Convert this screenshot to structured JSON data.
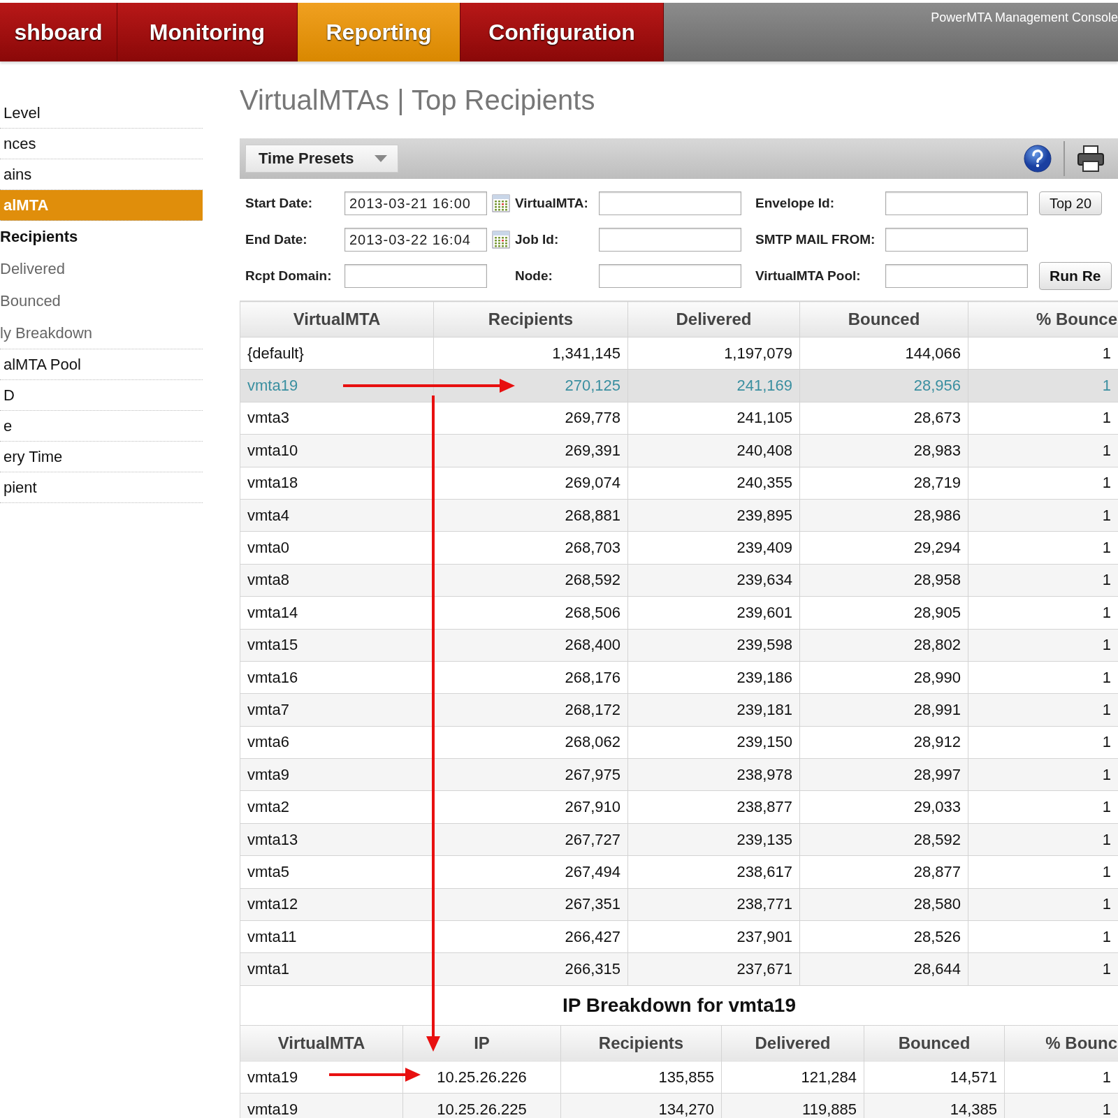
{
  "nav": {
    "tabs": [
      {
        "label": "shboard",
        "selected": false
      },
      {
        "label": "Monitoring",
        "selected": false
      },
      {
        "label": "Reporting",
        "selected": true
      },
      {
        "label": "Configuration",
        "selected": false
      }
    ],
    "console_title": "PowerMTA Management Console"
  },
  "sidebar": {
    "items": [
      {
        "label": "Level",
        "selected": false
      },
      {
        "label": "nces",
        "selected": false
      },
      {
        "label": "ains",
        "selected": false
      },
      {
        "label": "alMTA",
        "selected": true,
        "children": [
          {
            "label": "Recipients",
            "selected": true
          },
          {
            "label": "Delivered",
            "selected": false
          },
          {
            "label": "Bounced",
            "selected": false
          },
          {
            "label": "ly Breakdown",
            "selected": false
          }
        ]
      },
      {
        "label": "alMTA Pool",
        "selected": false
      },
      {
        "label": "D",
        "selected": false
      },
      {
        "label": "e",
        "selected": false
      },
      {
        "label": "ery Time",
        "selected": false
      },
      {
        "label": "pient",
        "selected": false
      }
    ]
  },
  "page_title": "VirtualMTAs | Top Recipients",
  "toolbar": {
    "time_presets": "Time Presets"
  },
  "form": {
    "rows": [
      {
        "fields": [
          {
            "label": "Start Date:",
            "kind": "date",
            "value": "2013-03-21 16:00"
          },
          {
            "label": "VirtualMTA:",
            "kind": "text"
          },
          {
            "label": "Envelope Id:",
            "kind": "text"
          }
        ],
        "extra": {
          "kind": "select",
          "label": "Top 20"
        }
      },
      {
        "fields": [
          {
            "label": "End Date:",
            "kind": "date",
            "value": "2013-03-22 16:04"
          },
          {
            "label": "Job Id:",
            "kind": "text"
          },
          {
            "label": "SMTP MAIL FROM:",
            "kind": "text"
          }
        ]
      },
      {
        "fields": [
          {
            "label": "Rcpt Domain:",
            "kind": "text"
          },
          {
            "label": "Node:",
            "kind": "text"
          },
          {
            "label": "VirtualMTA Pool:",
            "kind": "text"
          }
        ],
        "extra": {
          "kind": "button",
          "label": "Run Re"
        }
      }
    ]
  },
  "table": {
    "columns": [
      "VirtualMTA",
      "Recipients",
      "Delivered",
      "Bounced",
      "% Bounce"
    ],
    "rows": [
      {
        "selected": false,
        "cells": [
          "{default}",
          "1,341,145",
          "1,197,079",
          "144,066",
          "1"
        ]
      },
      {
        "selected": true,
        "cells": [
          "vmta19",
          "270,125",
          "241,169",
          "28,956",
          "1"
        ]
      },
      {
        "selected": false,
        "cells": [
          "vmta3",
          "269,778",
          "241,105",
          "28,673",
          "1"
        ]
      },
      {
        "selected": false,
        "cells": [
          "vmta10",
          "269,391",
          "240,408",
          "28,983",
          "1"
        ]
      },
      {
        "selected": false,
        "cells": [
          "vmta18",
          "269,074",
          "240,355",
          "28,719",
          "1"
        ]
      },
      {
        "selected": false,
        "cells": [
          "vmta4",
          "268,881",
          "239,895",
          "28,986",
          "1"
        ]
      },
      {
        "selected": false,
        "cells": [
          "vmta0",
          "268,703",
          "239,409",
          "29,294",
          "1"
        ]
      },
      {
        "selected": false,
        "cells": [
          "vmta8",
          "268,592",
          "239,634",
          "28,958",
          "1"
        ]
      },
      {
        "selected": false,
        "cells": [
          "vmta14",
          "268,506",
          "239,601",
          "28,905",
          "1"
        ]
      },
      {
        "selected": false,
        "cells": [
          "vmta15",
          "268,400",
          "239,598",
          "28,802",
          "1"
        ]
      },
      {
        "selected": false,
        "cells": [
          "vmta16",
          "268,176",
          "239,186",
          "28,990",
          "1"
        ]
      },
      {
        "selected": false,
        "cells": [
          "vmta7",
          "268,172",
          "239,181",
          "28,991",
          "1"
        ]
      },
      {
        "selected": false,
        "cells": [
          "vmta6",
          "268,062",
          "239,150",
          "28,912",
          "1"
        ]
      },
      {
        "selected": false,
        "cells": [
          "vmta9",
          "267,975",
          "238,978",
          "28,997",
          "1"
        ]
      },
      {
        "selected": false,
        "cells": [
          "vmta2",
          "267,910",
          "238,877",
          "29,033",
          "1"
        ]
      },
      {
        "selected": false,
        "cells": [
          "vmta13",
          "267,727",
          "239,135",
          "28,592",
          "1"
        ]
      },
      {
        "selected": false,
        "cells": [
          "vmta5",
          "267,494",
          "238,617",
          "28,877",
          "1"
        ]
      },
      {
        "selected": false,
        "cells": [
          "vmta12",
          "267,351",
          "238,771",
          "28,580",
          "1"
        ]
      },
      {
        "selected": false,
        "cells": [
          "vmta11",
          "266,427",
          "237,901",
          "28,526",
          "1"
        ]
      },
      {
        "selected": false,
        "cells": [
          "vmta1",
          "266,315",
          "237,671",
          "28,644",
          "1"
        ]
      }
    ]
  },
  "breakdown": {
    "title": "IP Breakdown for vmta19",
    "columns": [
      "VirtualMTA",
      "IP",
      "Recipients",
      "Delivered",
      "Bounced",
      "% Bounc"
    ],
    "rows": [
      {
        "cells": [
          "vmta19",
          "10.25.26.226",
          "135,855",
          "121,284",
          "14,571",
          "1"
        ]
      },
      {
        "cells": [
          "vmta19",
          "10.25.26.225",
          "134,270",
          "119,885",
          "14,385",
          "1"
        ]
      }
    ]
  }
}
